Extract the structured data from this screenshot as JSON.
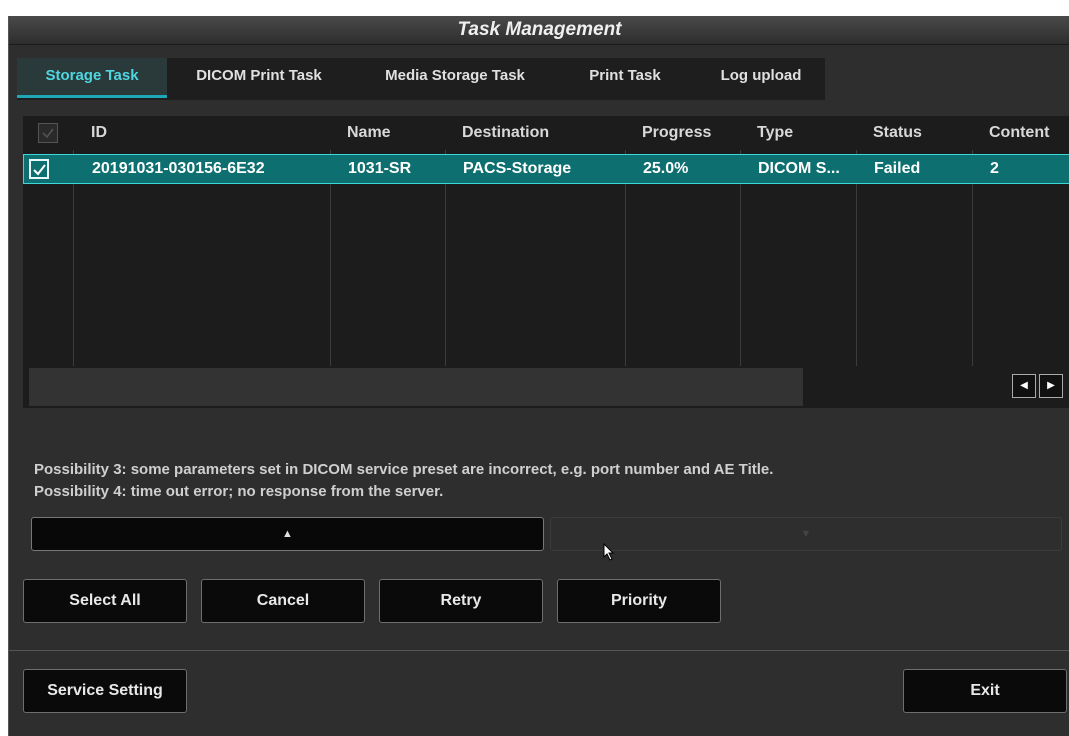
{
  "window": {
    "title": "Task Management"
  },
  "tabs": [
    {
      "label": "Storage Task",
      "active": true
    },
    {
      "label": "DICOM Print Task",
      "active": false
    },
    {
      "label": "Media Storage Task",
      "active": false
    },
    {
      "label": "Print Task",
      "active": false
    },
    {
      "label": "Log upload",
      "active": false
    }
  ],
  "table": {
    "columns": [
      "ID",
      "Name",
      "Destination",
      "Progress",
      "Type",
      "Status",
      "Content"
    ],
    "rows": [
      {
        "checked": true,
        "id": "20191031-030156-6E32",
        "name": "1031-SR",
        "destination": "PACS-Storage",
        "progress": "25.0%",
        "type": "DICOM S...",
        "status": "Failed",
        "content": "2"
      }
    ]
  },
  "message": {
    "line1": "Possibility 3: some parameters set in DICOM service preset are incorrect, e.g. port number and AE Title.",
    "line2": "Possibility 4: time out error; no response from the server."
  },
  "nav": {
    "up_icon": "▲",
    "down_icon": "▼"
  },
  "scroll": {
    "left_icon": "◀",
    "right_icon": "▶"
  },
  "buttons": {
    "select_all": "Select All",
    "cancel": "Cancel",
    "retry": "Retry",
    "priority": "Priority",
    "service_setting": "Service Setting",
    "exit": "Exit"
  },
  "colors": {
    "accent": "#1ea7b5",
    "row_selected": "#0e6f70",
    "background": "#2e2e2e"
  }
}
